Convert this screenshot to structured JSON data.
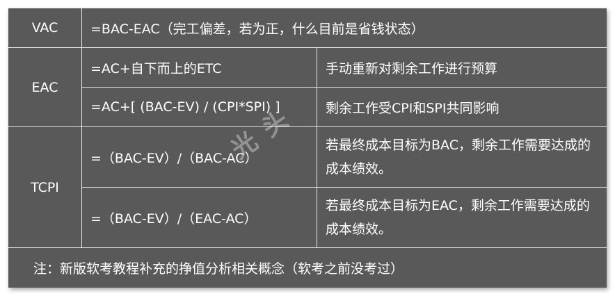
{
  "rows": {
    "vac": {
      "label": "VAC",
      "formula": "=BAC-EAC（完工偏差，若为正，什么目前是省钱状态）"
    },
    "eac": {
      "label": "EAC",
      "formula1": "=AC+自下而上的ETC",
      "desc1": "手动重新对剩余工作进行预算",
      "formula2": "=AC+[ (BAC-EV) / (CPI*SPI) ]",
      "desc2": "剩余工作受CPI和SPI共同影响"
    },
    "tcpi": {
      "label": "TCPI",
      "formula1": "=（BAC-EV）/（BAC-AC）",
      "desc1": "若最终成本目标为BAC，剩余工作需要达成的成本绩效。",
      "formula2": "=（BAC-EV）/（EAC-AC）",
      "desc2": "若最终成本目标为EAC，剩余工作需要达成的成本绩效。"
    }
  },
  "note": "注：新版软考教程补充的挣值分析相关概念（软考之前没考过）",
  "watermark": "光头"
}
